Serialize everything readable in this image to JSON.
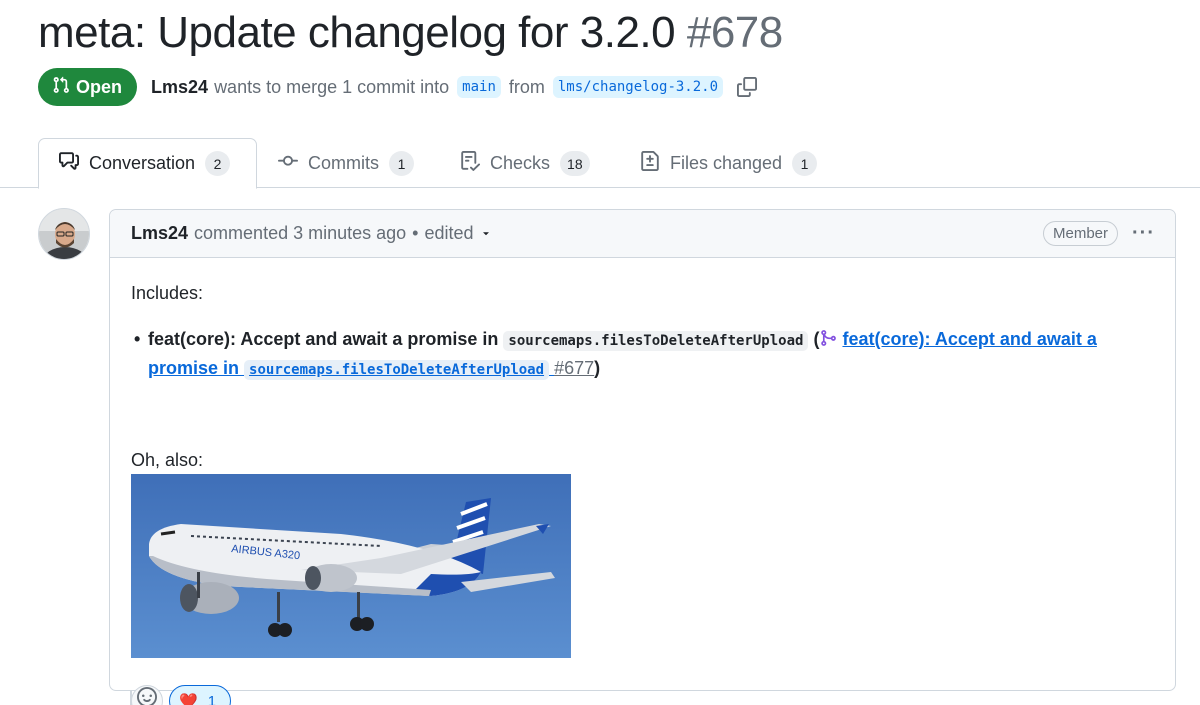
{
  "pr": {
    "title": "meta: Update changelog for 3.2.0",
    "number": "#678",
    "state": "Open",
    "author": "Lms24",
    "merge_text": "wants to merge 1 commit into",
    "base_branch": "main",
    "from_text": "from",
    "head_branch": "lms/changelog-3.2.0"
  },
  "tabs": [
    {
      "label": "Conversation",
      "count": "2",
      "icon": "comment-discussion-icon",
      "active": true
    },
    {
      "label": "Commits",
      "count": "1",
      "icon": "git-commit-icon"
    },
    {
      "label": "Checks",
      "count": "18",
      "icon": "checklist-icon"
    },
    {
      "label": "Files changed",
      "count": "1",
      "icon": "file-diff-icon"
    }
  ],
  "comment": {
    "author": "Lms24",
    "action": "commented 3 minutes ago",
    "separator": "•",
    "edited": "edited",
    "role": "Member",
    "menu": "···",
    "body": {
      "intro": "Includes:",
      "item_text": "feat(core): Accept and await a promise in ",
      "item_code": "sourcemaps.filesToDeleteAfterUpload",
      "link_text": "feat(core): Accept and await a promise in ",
      "link_code": "sourcemaps.filesToDeleteAfterUpload",
      "link_number": "#677",
      "outro": "Oh, also:",
      "image_alt": "Airbus A320 airplane in flight",
      "image_lettering": "AIRBUS A320"
    },
    "reactions": [
      {
        "emoji": "❤️",
        "count": "1",
        "icon": "heart-icon"
      }
    ]
  },
  "colors": {
    "open_green": "#1f883d",
    "link_blue": "#0969da",
    "muted": "#656d76"
  }
}
